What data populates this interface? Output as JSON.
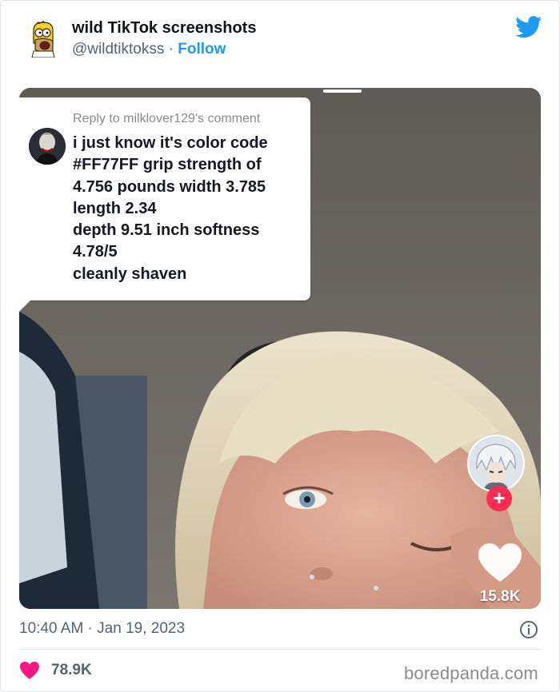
{
  "tweet": {
    "author_name": "wild TikTok screenshots",
    "handle": "@wildtiktokss",
    "separator": "·",
    "follow_label": "Follow",
    "timestamp": "10:40 AM · Jan 19, 2023",
    "like_count": "78.9K"
  },
  "tiktok": {
    "reply_to": "Reply to milklover129's comment",
    "comment_lines": [
      "i just know it's color code",
      "#FF77FF grip strength of",
      "4.756 pounds width 3.785",
      "length 2.34",
      "depth 9.51 inch softness",
      "4.78/5",
      "cleanly shaven"
    ],
    "like_count": "15.8K",
    "follow_plus": "+"
  },
  "watermark": "boredpanda.com",
  "colors": {
    "twitter_blue": "#1d9bf0",
    "like_red": "#f91880",
    "tiktok_red": "#fe2c55",
    "text_primary": "#0f1419",
    "text_secondary": "#536471"
  },
  "icons": {
    "author_avatar": "homer-simpson-avatar",
    "brand": "twitter-bird-icon",
    "info": "info-icon",
    "like": "heart-icon"
  }
}
